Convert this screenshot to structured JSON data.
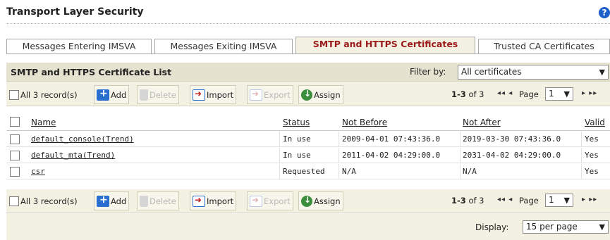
{
  "page": {
    "title": "Transport Layer Security",
    "help_icon": "?"
  },
  "tabs": [
    {
      "label": "Messages Entering IMSVA",
      "active": false
    },
    {
      "label": "Messages Exiting IMSVA",
      "active": false
    },
    {
      "label": "SMTP and HTTPS Certificates",
      "active": true
    },
    {
      "label": "Trusted CA Certificates",
      "active": false
    }
  ],
  "list": {
    "title": "SMTP and HTTPS Certificate List",
    "filter_label": "Filter by:",
    "filter_value": "All certificates"
  },
  "toolbar": {
    "all_records": "All 3 record(s)",
    "add": "Add",
    "delete": "Delete",
    "import": "Import",
    "export": "Export",
    "assign": "Assign",
    "range": "1-3",
    "of_total": "of 3",
    "page_label": "Page",
    "page_value": "1",
    "first_prev": "◂◂ ◂",
    "next_last": "▸ ▸▸"
  },
  "table": {
    "columns": [
      "Name",
      "Status",
      "Not Before",
      "Not After",
      "Valid"
    ],
    "rows": [
      {
        "name": "default_console(Trend)",
        "status": "In use",
        "not_before": "2009-04-01 07:43:36.0",
        "not_after": "2019-03-30 07:43:36.0",
        "valid": "Yes"
      },
      {
        "name": "default_mta(Trend)",
        "status": "In use",
        "not_before": "2011-04-02 04:29:00.0",
        "not_after": "2031-04-02 04:29:00.0",
        "valid": "Yes"
      },
      {
        "name": "csr",
        "status": "Requested",
        "not_before": "N/A",
        "not_after": "N/A",
        "valid": "Yes"
      }
    ]
  },
  "footer": {
    "display_label": "Display:",
    "display_value": "15 per page"
  },
  "colors": {
    "active_tab_text": "#9b1a1a",
    "header_bg": "#e5e3cf",
    "toolbar_bg": "#f3f1e2"
  }
}
